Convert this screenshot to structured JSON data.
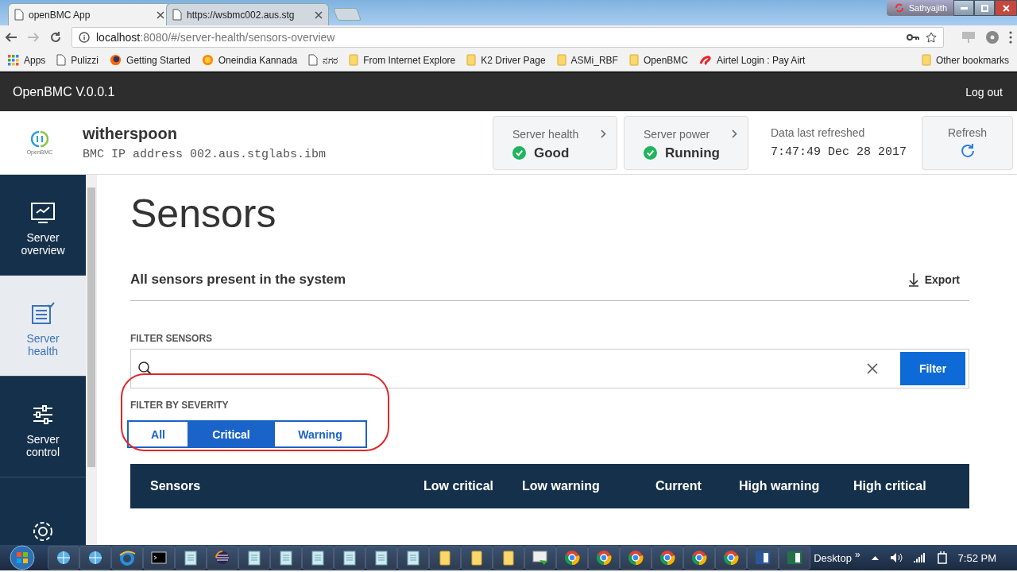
{
  "browser": {
    "tabs": [
      {
        "title": "openBMC App",
        "selected": true
      },
      {
        "title": "https://wsbmc002.aus.stg",
        "selected": false
      }
    ],
    "profile": "Sathyajith",
    "url_host": "localhost",
    "url_rest": ":8080/#/server-health/sensors-overview",
    "bookmarks": [
      {
        "label": "Apps",
        "kind": "apps"
      },
      {
        "label": "Pulizzi",
        "kind": "page"
      },
      {
        "label": "Getting Started",
        "kind": "firefox"
      },
      {
        "label": "Oneindia Kannada",
        "kind": "sun"
      },
      {
        "label": "ನಗರ",
        "kind": "page"
      },
      {
        "label": "From Internet Explore",
        "kind": "folder"
      },
      {
        "label": "K2 Driver Page",
        "kind": "folder"
      },
      {
        "label": "ASMi_RBF",
        "kind": "folder"
      },
      {
        "label": "OpenBMC",
        "kind": "folder"
      },
      {
        "label": "Airtel Login : Pay Airt",
        "kind": "airtel"
      }
    ],
    "other_bookmarks": "Other bookmarks"
  },
  "app_bar": {
    "title": "OpenBMC V.0.0.1",
    "logout": "Log out"
  },
  "header": {
    "logo_caption": "OpenBMC",
    "server_name": "witherspoon",
    "ip": "BMC IP address 002.aus.stglabs.ibm",
    "status_cards": [
      {
        "label": "Server health",
        "value": "Good"
      },
      {
        "label": "Server power",
        "value": "Running"
      }
    ],
    "refreshed_label": "Data last refreshed",
    "refreshed_time": "7:47:49 Dec 28 2017",
    "refresh": "Refresh"
  },
  "sidebar": {
    "items": [
      {
        "label": "Server overview",
        "kind": "overview",
        "selected": false
      },
      {
        "label": "Server health",
        "kind": "health",
        "selected": true
      },
      {
        "label": "Server control",
        "kind": "control",
        "selected": false
      },
      {
        "kind": "settings",
        "selected": false
      }
    ]
  },
  "content": {
    "title": "Sensors",
    "subtitle": "All sensors present in the system",
    "export": "Export",
    "filter_label": "FILTER SENSORS",
    "filter_button": "Filter",
    "severity_label": "FILTER BY SEVERITY",
    "severities": [
      {
        "label": "All",
        "selected": false
      },
      {
        "label": "Critical",
        "selected": true
      },
      {
        "label": "Warning",
        "selected": false
      }
    ],
    "columns": [
      "Sensors",
      "Low critical",
      "Low warning",
      "Current",
      "High warning",
      "High critical"
    ]
  },
  "taskbar": {
    "apps": [
      {
        "kind": "network"
      },
      {
        "kind": "network"
      },
      {
        "kind": "ie"
      },
      {
        "kind": "cmd"
      },
      {
        "kind": "notepad"
      },
      {
        "kind": "eclipse"
      },
      {
        "kind": "notepad"
      },
      {
        "kind": "notepad"
      },
      {
        "kind": "notepad"
      },
      {
        "kind": "notepad"
      },
      {
        "kind": "notepad"
      },
      {
        "kind": "notepad"
      },
      {
        "kind": "folder"
      },
      {
        "kind": "folder"
      },
      {
        "kind": "folder"
      },
      {
        "kind": "remote"
      },
      {
        "kind": "chrome"
      },
      {
        "kind": "chrome"
      },
      {
        "kind": "chrome"
      },
      {
        "kind": "chrome"
      },
      {
        "kind": "chrome"
      },
      {
        "kind": "chrome"
      },
      {
        "kind": "word"
      },
      {
        "kind": "excel"
      }
    ],
    "desktop": "Desktop",
    "more": "»",
    "clock": "7:52 PM"
  }
}
